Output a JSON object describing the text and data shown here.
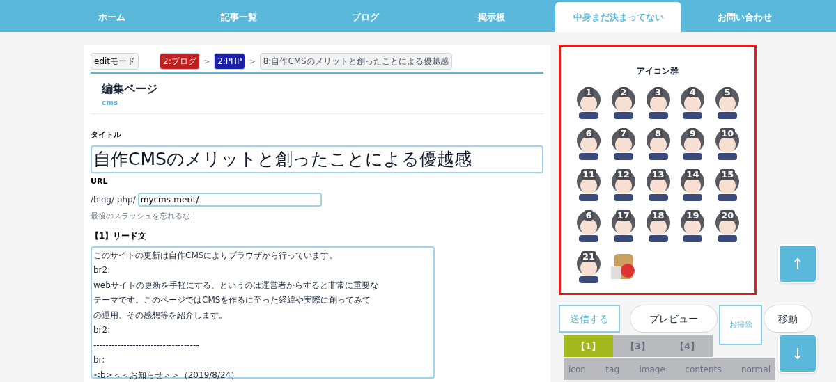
{
  "nav": {
    "items": [
      {
        "label": "ホーム",
        "selected": false
      },
      {
        "label": "記事一覧",
        "selected": false
      },
      {
        "label": "ブログ",
        "selected": false
      },
      {
        "label": "掲示板",
        "selected": false
      },
      {
        "label": "中身まだ決まってない",
        "selected": true
      },
      {
        "label": "お問い合わせ",
        "selected": false
      }
    ]
  },
  "editor": {
    "mode_button": "editモード",
    "breadcrumbs": [
      {
        "label": "2:ブログ",
        "color": "#c0201f"
      },
      {
        "label": "2:PHP",
        "color": "#1c1fa8"
      },
      {
        "label": "8:自作CMSのメリットと創ったことによる優越感",
        "color": "#f2f2f2"
      }
    ],
    "separator": ">",
    "heading": "編集ページ",
    "subheading": "cms",
    "title_label": "タイトル",
    "title_value": "自作CMSのメリットと創ったことによる優越感",
    "url_label": "URL",
    "url_prefix": "/blog/ php/",
    "url_value": "mycms-merit/",
    "url_hint": "最後のスラッシュを忘れるな！",
    "lead_label": "【1】リード文",
    "lead_lines": [
      "このサイトの更新は自作CMSによりブラウザから行っています。",
      "br2:",
      "webサイトの更新を手軽にする、というのは運営者からすると非常に重要な",
      "テーマです。このページではCMSを作るに至った経緯や実際に創ってみて",
      "の運用、その感想等を紹介します。",
      "br2:",
      "-----------------------------------",
      "br:",
      "<b>＜＜お知らせ＞＞（2019/8/24）"
    ]
  },
  "icon_panel": {
    "title": "アイコン群",
    "icons": [
      {
        "number": "1"
      },
      {
        "number": "2"
      },
      {
        "number": "3"
      },
      {
        "number": "4"
      },
      {
        "number": "5"
      },
      {
        "number": "6"
      },
      {
        "number": "7"
      },
      {
        "number": "8"
      },
      {
        "number": "9"
      },
      {
        "number": "10"
      },
      {
        "number": "11"
      },
      {
        "number": "12"
      },
      {
        "number": "13"
      },
      {
        "number": "14"
      },
      {
        "number": "15"
      },
      {
        "number": "6"
      },
      {
        "number": "17"
      },
      {
        "number": "18"
      },
      {
        "number": "19"
      },
      {
        "number": "20"
      },
      {
        "number": "21"
      },
      {
        "kind": "robot"
      }
    ]
  },
  "actions": [
    {
      "label": "送信する",
      "kind": "outline"
    },
    {
      "label": "プレビュー",
      "kind": "pill"
    },
    {
      "label": "お掃除",
      "kind": "outline"
    },
    {
      "label": "移動",
      "kind": "pill"
    }
  ],
  "scroll_buttons": {
    "up": "↑",
    "down": "↓"
  },
  "section_tabs": [
    {
      "label": "【1】",
      "selected": true
    },
    {
      "label": "【3】",
      "selected": false
    },
    {
      "label": "【4】",
      "selected": false
    }
  ],
  "tag_buttons": [
    "icon",
    "tag",
    "image",
    "contents",
    "normal"
  ]
}
